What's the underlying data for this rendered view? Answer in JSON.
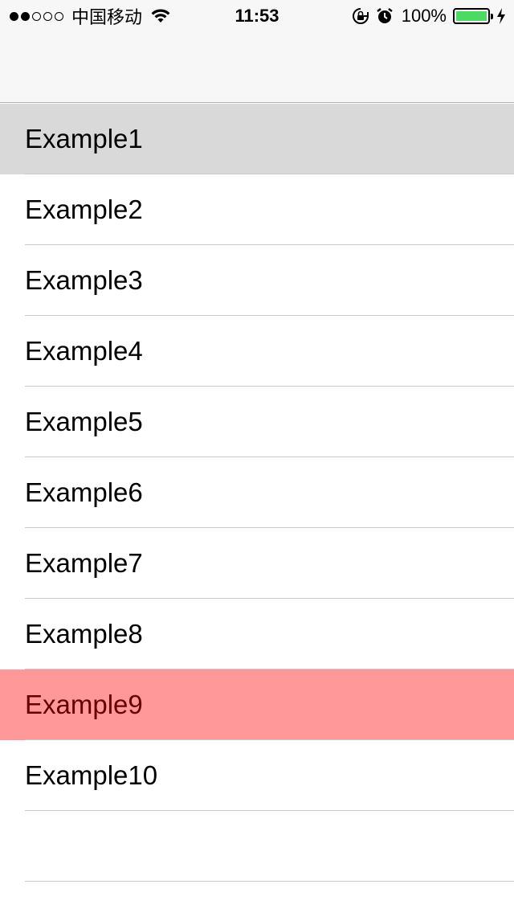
{
  "status_bar": {
    "carrier": "中国移动",
    "time": "11:53",
    "battery_percent": "100%",
    "battery_level": 1.0,
    "signal_bars_filled": 2,
    "signal_bars_total": 5,
    "battery_color": "#4cd964"
  },
  "list": {
    "items": [
      {
        "label": "Example1",
        "state": "selected"
      },
      {
        "label": "Example2",
        "state": "normal"
      },
      {
        "label": "Example3",
        "state": "normal"
      },
      {
        "label": "Example4",
        "state": "normal"
      },
      {
        "label": "Example5",
        "state": "normal"
      },
      {
        "label": "Example6",
        "state": "normal"
      },
      {
        "label": "Example7",
        "state": "normal"
      },
      {
        "label": "Example8",
        "state": "normal"
      },
      {
        "label": "Example9",
        "state": "highlighted"
      },
      {
        "label": "Example10",
        "state": "normal"
      }
    ],
    "selected_color": "#d9d9d9",
    "highlight_color": "#ff9999",
    "highlight_text_color": "#660000"
  }
}
